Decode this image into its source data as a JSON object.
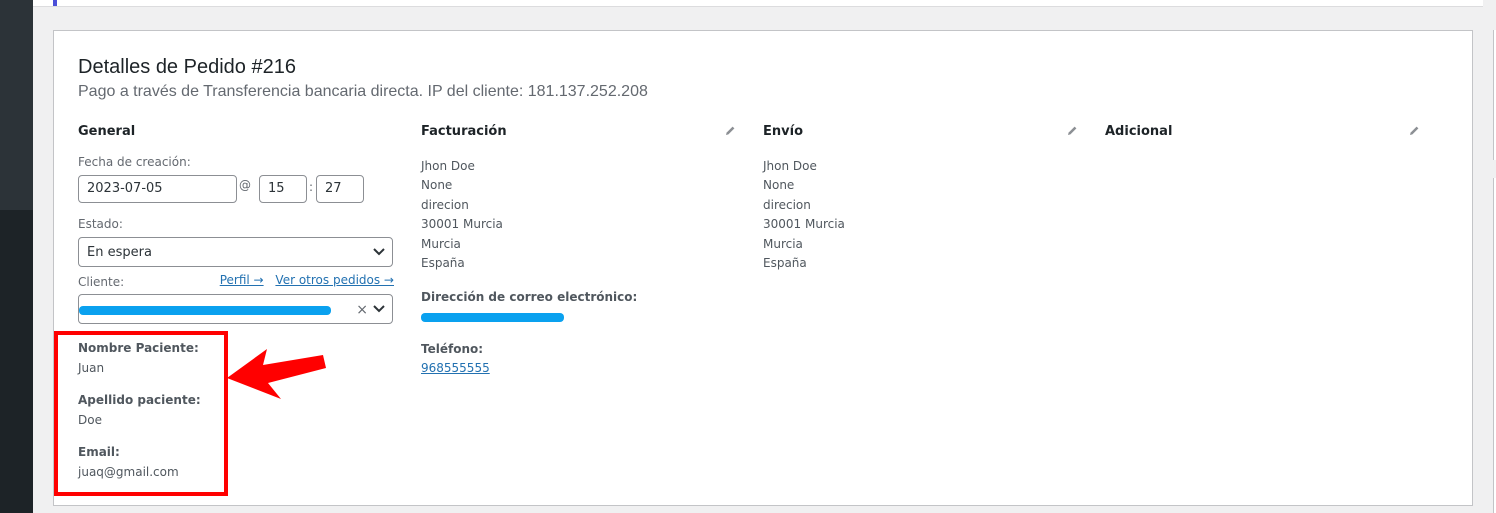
{
  "order": {
    "title": "Detalles de Pedido #216",
    "subtitle": "Pago a través de Transferencia bancaria directa. IP del cliente: 181.137.252.208"
  },
  "general": {
    "heading": "General",
    "creation_date_label": "Fecha de creación:",
    "date_value": "2023-07-05",
    "at_symbol": "@",
    "hour_value": "15",
    "time_separator": ":",
    "minute_value": "27",
    "status_label": "Estado:",
    "status_value": "En espera",
    "customer_label": "Cliente:",
    "profile_link": "Perfil →",
    "other_orders_link": "Ver otros pedidos →",
    "clear_symbol": "×"
  },
  "patient": {
    "name_label": "Nombre Paciente:",
    "name_value": "Juan",
    "surname_label": "Apellido paciente:",
    "surname_value": "Doe",
    "email_label": "Email:",
    "email_value": "juaq@gmail.com"
  },
  "billing": {
    "heading": "Facturación",
    "address_lines": [
      "Jhon Doe",
      "None",
      "direcion",
      "30001 Murcia",
      "Murcia",
      "España"
    ],
    "email_label": "Dirección de correo electrónico:",
    "phone_label": "Teléfono:",
    "phone_value": "968555555"
  },
  "shipping": {
    "heading": "Envío",
    "address_lines": [
      "Jhon Doe",
      "None",
      "direcion",
      "30001 Murcia",
      "Murcia",
      "España"
    ]
  },
  "additional": {
    "heading": "Adicional"
  },
  "icons": {
    "edit": "pencil-icon",
    "select": "chevron-down-icon",
    "annotation": "red-arrow-icon"
  },
  "colors": {
    "accent": "#2271b1",
    "annotation": "#ff0000",
    "redaction": "#0aa1ef",
    "admin_sidebar": "#1d2327"
  }
}
